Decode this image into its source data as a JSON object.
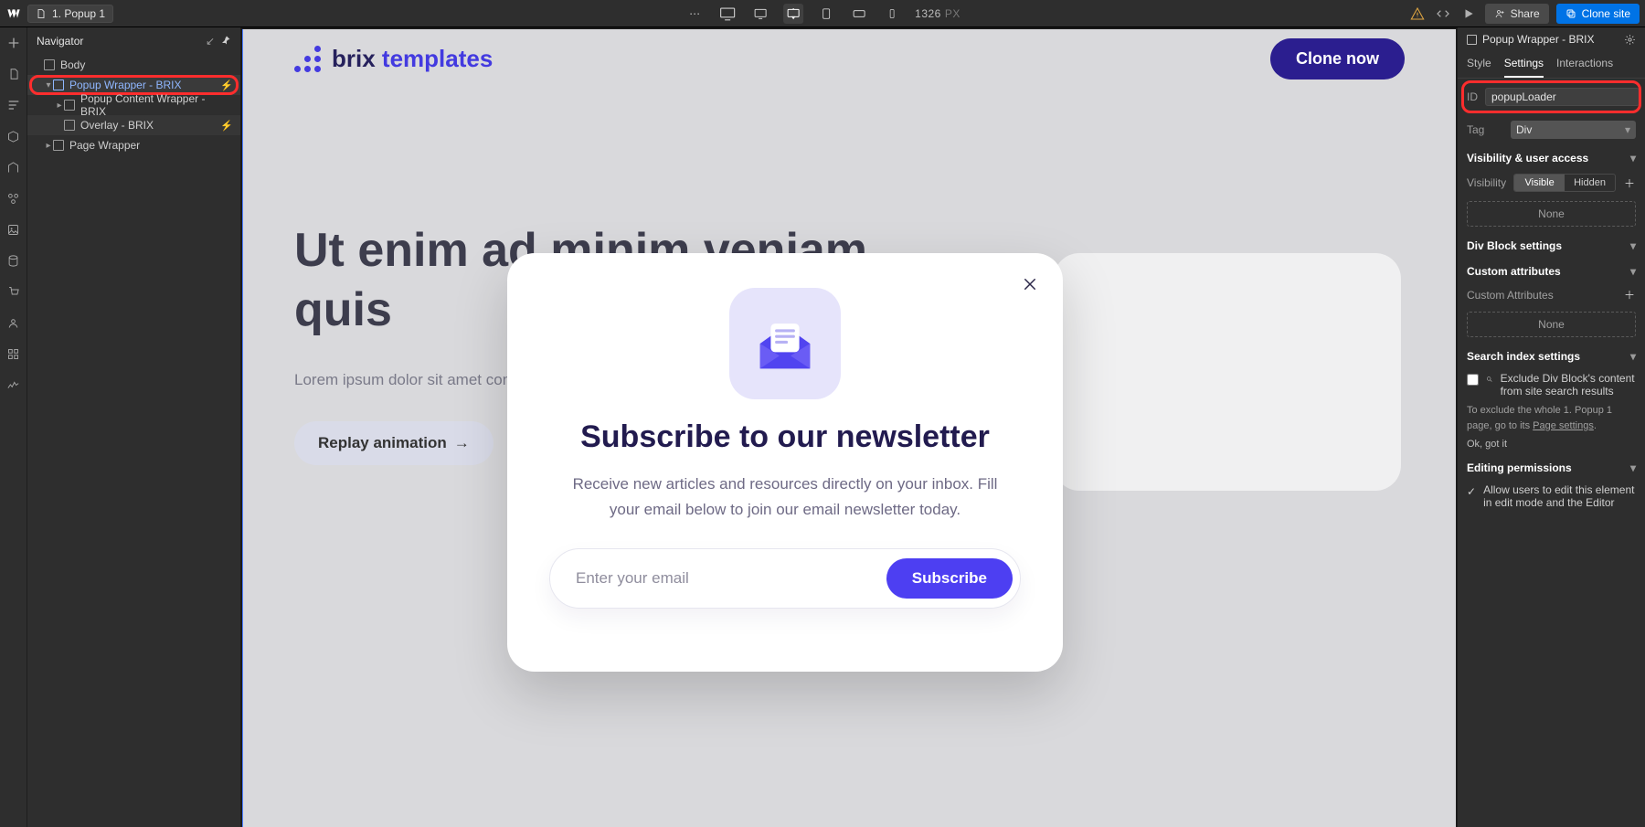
{
  "topbar": {
    "page_name": "1. Popup 1",
    "breakpoint_width": "1326",
    "breakpoint_unit": "PX",
    "share_label": "Share",
    "clone_label": "Clone site"
  },
  "navigator": {
    "title": "Navigator",
    "tree": {
      "body": "Body",
      "popup_wrapper": "Popup Wrapper - BRIX",
      "popup_content_wrapper": "Popup Content Wrapper - BRIX",
      "overlay": "Overlay - BRIX",
      "page_wrapper": "Page Wrapper"
    }
  },
  "canvas": {
    "brand_left": "brix",
    "brand_right": "templates",
    "clone_now": "Clone now",
    "hero_heading": "Ut enim ad minim veniam quis",
    "hero_body": "Lorem ipsum dolor sit amet consectetur condim entum justo quis pellentesque.",
    "replay_label": "Replay animation"
  },
  "popup": {
    "heading": "Subscribe to our newsletter",
    "subtext": "Receive new articles and resources directly on your inbox. Fill your email below to join our email newsletter today.",
    "email_placeholder": "Enter your email",
    "subscribe_label": "Subscribe"
  },
  "settings": {
    "selected_element": "Popup Wrapper - BRIX",
    "tabs": {
      "style": "Style",
      "settings": "Settings",
      "interactions": "Interactions"
    },
    "id_label": "ID",
    "id_value": "popupLoader",
    "tag_label": "Tag",
    "tag_value": "Div",
    "visibility_section": "Visibility & user access",
    "visibility_label": "Visibility",
    "visible_opt": "Visible",
    "hidden_opt": "Hidden",
    "none_label": "None",
    "divblock_section": "Div Block settings",
    "custom_attr_section": "Custom attributes",
    "custom_attr_label": "Custom Attributes",
    "search_section": "Search index settings",
    "search_exclude_text": "Exclude Div Block's content from site search results",
    "search_hint_1": "To exclude the whole 1. Popup 1 page, go to its ",
    "search_hint_link": "Page settings",
    "search_hint_2": ".",
    "ok_got_it": "Ok, got it",
    "editing_section": "Editing permissions",
    "editing_text": "Allow users to edit this element in edit mode and the Editor"
  }
}
